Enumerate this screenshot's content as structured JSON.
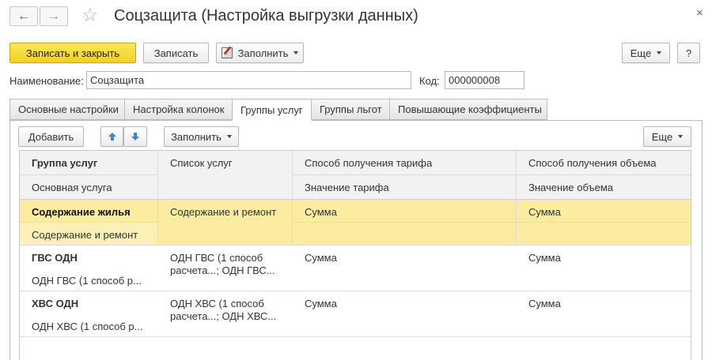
{
  "window": {
    "title": "Соцзащита (Настройка выгрузки данных)",
    "back_icon": "←",
    "forward_icon": "→",
    "star_icon": "☆",
    "close_icon": "×"
  },
  "toolbar": {
    "save_close_label": "Записать и закрыть",
    "save_label": "Записать",
    "fill_label": "Заполнить",
    "more_label": "Еще",
    "help_label": "?"
  },
  "form": {
    "name_label": "Наименование:",
    "name_value": "Соцзащита",
    "code_label": "Код:",
    "code_value": "000000008"
  },
  "tabs": [
    {
      "label": "Основные настройки"
    },
    {
      "label": "Настройка колонок"
    },
    {
      "label": "Группы услуг"
    },
    {
      "label": "Группы льгот"
    },
    {
      "label": "Повышающие коэффициенты"
    }
  ],
  "active_tab": "Группы услуг",
  "table_toolbar": {
    "add_label": "Добавить",
    "fill_label": "Заполнить",
    "more_label": "Еще"
  },
  "table": {
    "headers": {
      "col1_top": "Группа услуг",
      "col1_bottom": "Основная услуга",
      "col2": "Список услуг",
      "col3_top": "Способ получения тарифа",
      "col3_bottom": "Значение тарифа",
      "col4_top": "Способ получения объема",
      "col4_bottom": "Значение объема"
    },
    "rows": [
      {
        "group": "Содержание жилья",
        "main_service": "Содержание и ремонт",
        "services_line1": "Содержание и ремонт",
        "services_line2": "",
        "tariff_method": "Сумма",
        "volume_method": "Сумма"
      },
      {
        "group": "ГВС ОДН",
        "main_service": "ОДН ГВС (1 способ р...",
        "services_line1": "ОДН ГВС (1 способ",
        "services_line2": "расчета...; ОДН ГВС...",
        "tariff_method": "Сумма",
        "volume_method": "Сумма"
      },
      {
        "group": "ХВС ОДН",
        "main_service": "ОДН ХВС (1 способ р...",
        "services_line1": "ОДН ХВС (1 способ",
        "services_line2": "расчета...; ОДН ХВС...",
        "tariff_method": "Сумма",
        "volume_method": "Сумма"
      }
    ]
  },
  "colors": {
    "primary_button": "#f5d630",
    "selected_row": "#fbeca0",
    "accent_blue": "#3a87d8"
  }
}
